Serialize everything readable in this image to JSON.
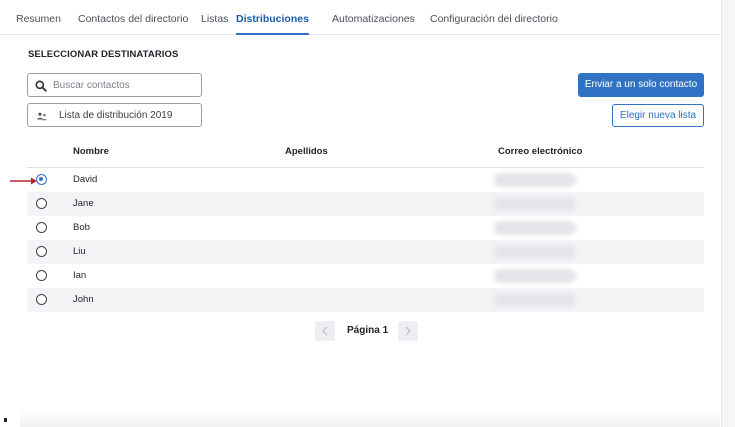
{
  "tabs": [
    {
      "label": "Resumen",
      "active": false
    },
    {
      "label": "Contactos del directorio",
      "active": false
    },
    {
      "label": "Listas",
      "active": false
    },
    {
      "label": "Distribuciones",
      "active": true
    },
    {
      "label": "Automatizaciones",
      "active": false
    },
    {
      "label": "Configuración del directorio",
      "active": false
    }
  ],
  "section_title": "SELECCIONAR DESTINATARIOS",
  "search": {
    "placeholder": "Buscar contactos",
    "value": ""
  },
  "distribution_list": {
    "label": "Lista de distribución 2019"
  },
  "buttons": {
    "send_single": "Enviar a un solo contacto",
    "choose_list": "Elegir nueva lista"
  },
  "table": {
    "columns": [
      "Nombre",
      "Apellidos",
      "Correo electrónico"
    ],
    "rows": [
      {
        "name": "David",
        "selected": true
      },
      {
        "name": "Jane",
        "selected": false
      },
      {
        "name": "Bob",
        "selected": false
      },
      {
        "name": "Liu",
        "selected": false
      },
      {
        "name": "Ian",
        "selected": false
      },
      {
        "name": "John",
        "selected": false
      }
    ]
  },
  "pagination": {
    "label": "Página 1"
  },
  "colors": {
    "accent": "#3172c4",
    "annotation_arrow": "#b3262d"
  },
  "icons": [
    "search-icon",
    "people-icon",
    "chevron-left-icon",
    "chevron-right-icon",
    "red-arrow-icon"
  ]
}
